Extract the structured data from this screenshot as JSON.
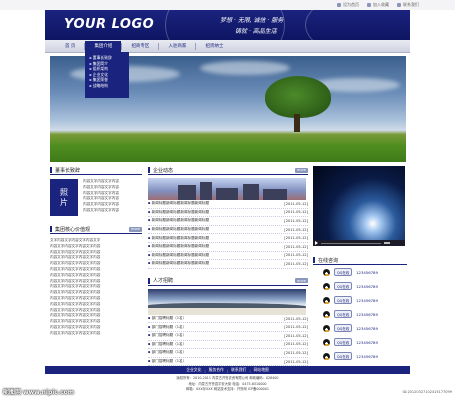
{
  "top_links": [
    {
      "label": "设为首页"
    },
    {
      "label": "加入收藏"
    },
    {
      "label": "联系我们"
    }
  ],
  "header": {
    "logo": "YOUR LOGO",
    "slogan_line1": "梦想 · 无限, 诚信 · 服务",
    "slogan_line2": "铸就 · 高品生活",
    "brand_color": "#1a237e"
  },
  "nav": {
    "items": [
      "首 页",
      "集团介绍",
      "招商专区",
      "入驻商家",
      "招贤纳士"
    ],
    "active_index": 1
  },
  "dropdown": {
    "items": [
      "董事长致辞",
      "集团简介",
      "组织架构",
      "企业文化",
      "集团荣誉",
      "战略结构"
    ]
  },
  "ceo": {
    "title": "董事长致辞",
    "more": "more",
    "photo_label_1": "照",
    "photo_label_2": "片",
    "lines": [
      "内容文字内容文字内容",
      "内容文字内容文字内容",
      "内容文字内容文字内容",
      "内容文字内容文字内容",
      "内容文字内容文字内容",
      "内容文字内容文字内容"
    ]
  },
  "philosophy": {
    "title": "集团核心价值观",
    "more": "more",
    "lines": [
      "文字内容文字内容文字内容文字",
      "内容文字内容文字内容文字内容",
      "内容文字内容文字内容文字内容",
      "内容文字内容文字内容文字内容",
      "内容文字内容文字内容文字内容",
      "内容文字内容文字内容文字内容",
      "内容文字内容文字内容文字内容",
      "内容文字内容文字内容文字内容",
      "内容文字内容文字内容文字内容",
      "内容文字内容文字内容文字内容",
      "内容文字内容文字内容文字内容",
      "内容文字内容文字内容文字内容",
      "内容文字内容文字内容文字内容",
      "内容文字内容文字内容文字内容",
      "内容文字内容文字内容文字内容",
      "内容文字内容文字内容文字内容",
      "内容文字内容文字内容文字内容"
    ]
  },
  "news": {
    "title": "企业动态",
    "more": "more",
    "items": [
      {
        "title": "新闻标题新闻标题新闻标题新闻标题",
        "date": "[2011-05-12]"
      },
      {
        "title": "新闻标题新闻标题新闻标题新闻标题",
        "date": "[2011-05-12]"
      },
      {
        "title": "新闻标题新闻标题新闻标题新闻标题",
        "date": "[2011-05-12]"
      },
      {
        "title": "新闻标题新闻标题新闻标题新闻标题",
        "date": "[2011-05-12]"
      },
      {
        "title": "新闻标题新闻标题新闻标题新闻标题",
        "date": "[2011-05-12]"
      },
      {
        "title": "新闻标题新闻标题新闻标题新闻标题",
        "date": "[2011-05-12]"
      },
      {
        "title": "新闻标题新闻标题新闻标题新闻标题",
        "date": "[2011-05-12]"
      },
      {
        "title": "新闻标题新闻标题新闻标题新闻标题",
        "date": "[2011-05-12]"
      }
    ]
  },
  "talent": {
    "title": "人才招聘",
    "more": "more",
    "items": [
      {
        "title": "部门招聘标题（1名）",
        "date": "[2011-05-12]"
      },
      {
        "title": "部门招聘标题（1名）",
        "date": "[2011-05-12]"
      },
      {
        "title": "部门招聘标题（1名）",
        "date": "[2011-05-12]"
      },
      {
        "title": "部门招聘标题（1名）",
        "date": "[2011-05-12]"
      },
      {
        "title": "部门招聘标题（1名）",
        "date": "[2011-05-12]"
      },
      {
        "title": "部门招聘标题（1名）",
        "date": "[2011-05-12]"
      }
    ]
  },
  "support": {
    "title": "在线咨询",
    "items": [
      {
        "button": "QQ在线",
        "number": "123456789"
      },
      {
        "button": "QQ在线",
        "number": "123456789"
      },
      {
        "button": "QQ在线",
        "number": "123456789"
      },
      {
        "button": "QQ在线",
        "number": "123456789"
      },
      {
        "button": "QQ在线",
        "number": "123456789"
      },
      {
        "button": "QQ在线",
        "number": "123456789"
      },
      {
        "button": "QQ在线",
        "number": "123456789"
      }
    ]
  },
  "footer": {
    "links": [
      "企业文化",
      "服务合作",
      "联系我们",
      "网站地图"
    ],
    "lines": [
      "版权所有：2010-2011 内蒙古开鲁农资有限公司 邮政编码：028400",
      "地址：内蒙古开鲁县平安大街 电话：0475-6510000",
      "邮箱：XXX@XXX 网站技术支持：开鲁网 ICP备000001"
    ]
  },
  "watermark_left": "昵图网 www.nipic.com",
  "watermark_right": "ID:20120327102415177099"
}
